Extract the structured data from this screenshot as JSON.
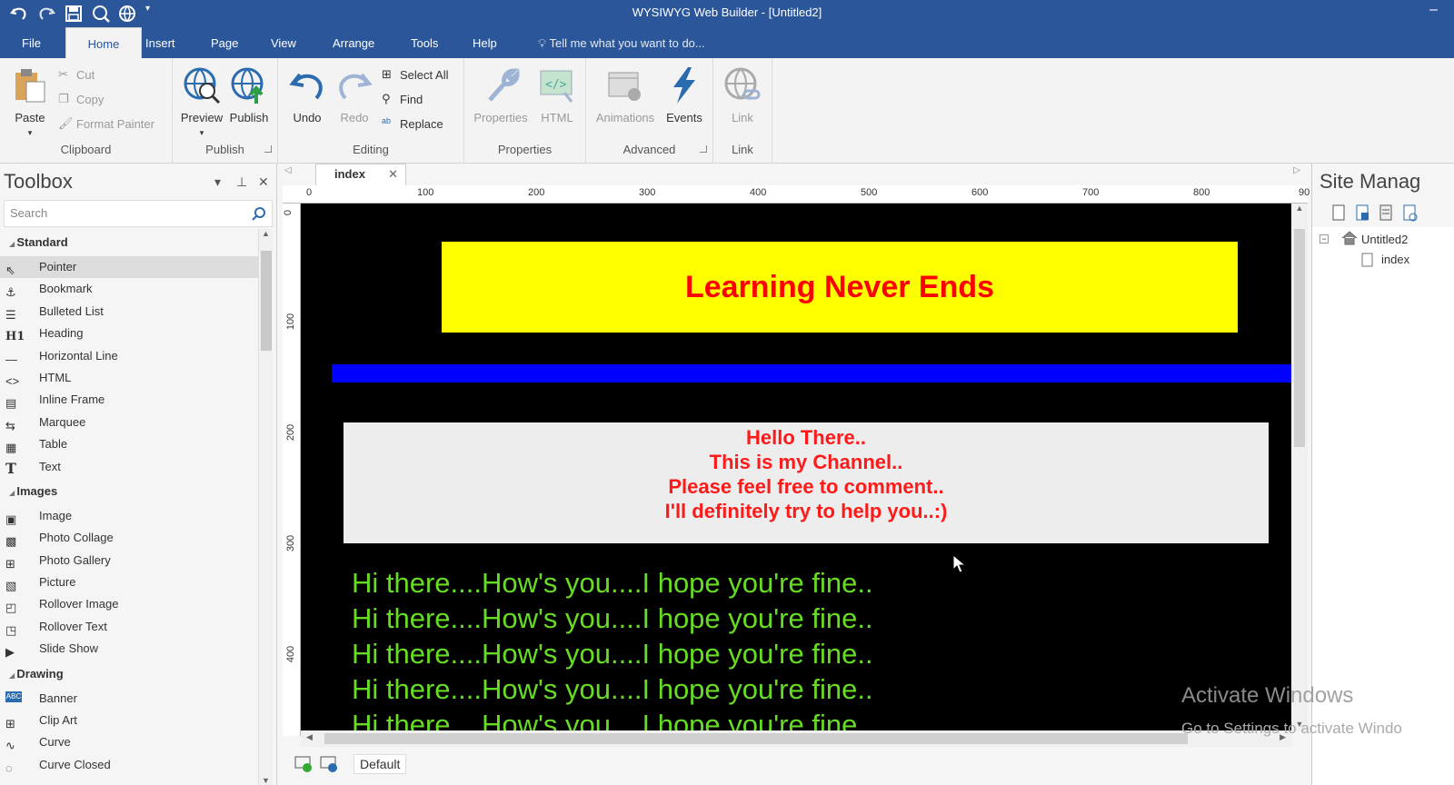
{
  "window": {
    "title": "WYSIWYG Web Builder - [Untitled2]",
    "minimize": "–"
  },
  "menu": {
    "tabs": [
      "File",
      "Home",
      "Insert",
      "Page",
      "View",
      "Arrange",
      "Tools",
      "Help"
    ],
    "tell_me": "Tell me what you want to do..."
  },
  "ribbon": {
    "clipboard": {
      "label": "Clipboard",
      "paste": "Paste",
      "cut": "Cut",
      "copy": "Copy",
      "format_painter": "Format Painter"
    },
    "publish": {
      "label": "Publish",
      "preview": "Preview",
      "publish": "Publish"
    },
    "editing": {
      "label": "Editing",
      "undo": "Undo",
      "redo": "Redo",
      "select_all": "Select All",
      "find": "Find",
      "replace": "Replace"
    },
    "properties": {
      "label": "Properties",
      "properties": "Properties",
      "html": "HTML"
    },
    "advanced": {
      "label": "Advanced",
      "animations": "Animations",
      "events": "Events"
    },
    "link": {
      "label": "Link",
      "link": "Link"
    }
  },
  "toolbox": {
    "title": "Toolbox",
    "search_placeholder": "Search",
    "categories": [
      {
        "name": "Standard",
        "items": [
          "Pointer",
          "Bookmark",
          "Bulleted List",
          "Heading",
          "Horizontal Line",
          "HTML",
          "Inline Frame",
          "Marquee",
          "Table",
          "Text"
        ]
      },
      {
        "name": "Images",
        "items": [
          "Image",
          "Photo Collage",
          "Photo Gallery",
          "Picture",
          "Rollover Image",
          "Rollover Text",
          "Slide Show"
        ]
      },
      {
        "name": "Drawing",
        "items": [
          "Banner",
          "Clip Art",
          "Curve",
          "Curve Closed"
        ]
      }
    ]
  },
  "document": {
    "tab": "index",
    "ruler_h": [
      "0",
      "100",
      "200",
      "300",
      "400",
      "500",
      "600",
      "700",
      "800",
      "90"
    ],
    "ruler_v": [
      "0",
      "100",
      "200",
      "300",
      "400"
    ],
    "banner_text": "Learning Never Ends",
    "message_lines": [
      "Hello There..",
      "This is my Channel..",
      "Please feel free to comment..",
      "I'll definitely try to help you..:)"
    ],
    "marquee_lines": [
      "Hi there....How's you....I hope you're fine..",
      "Hi there....How's you....I hope you're fine..",
      "Hi there....How's you....I hope you're fine..",
      "Hi there....How's you....I hope you're fine..",
      "Hi there....How's you....I hope you're fine.."
    ],
    "breakpoint": "Default"
  },
  "site_manager": {
    "title": "Site Manag",
    "root": "Untitled2",
    "page": "index"
  },
  "watermark": {
    "line1": "Activate Windows",
    "line2": "Go to Settings to activate Windo"
  },
  "colors": {
    "titlebar": "#2b579a",
    "banner_bg": "#ffff00",
    "banner_text": "#ff0000",
    "blue_line": "#0000ff",
    "marquee_text": "#66dd22",
    "message_text": "#ff1a1a"
  }
}
